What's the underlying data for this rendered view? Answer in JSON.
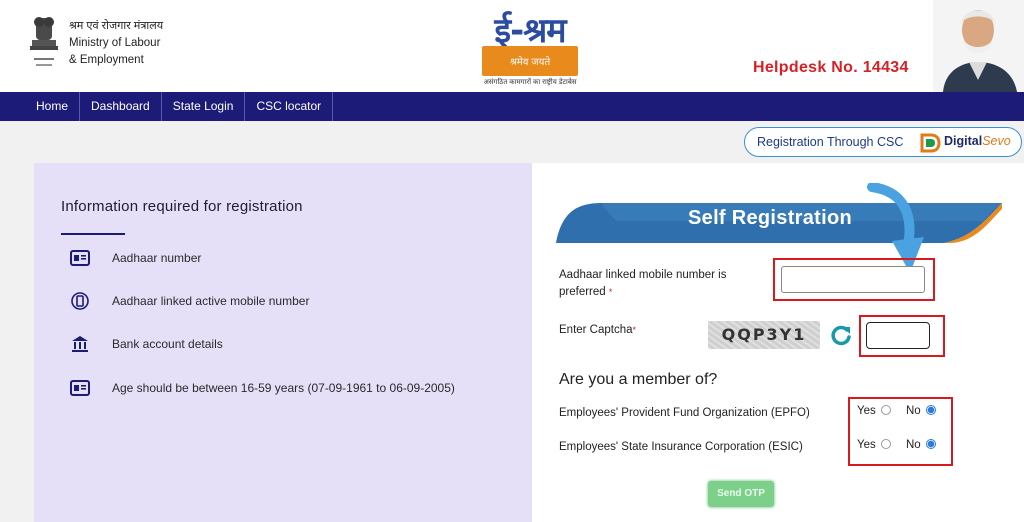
{
  "header": {
    "ministry_hindi": "श्रम एवं रोजगार मंत्रालय",
    "ministry_line1": "Ministry of Labour",
    "ministry_line2": "& Employment",
    "logo_title": "ई-श्रम",
    "logo_subtitle": "श्रमेव जयते",
    "logo_tagline": "असंगठित कामगारों का राष्ट्रीय डेटाबेस",
    "helpdesk": "Helpdesk No. 14434",
    "icons": [
      "national-emblem",
      "eshram-logo",
      "portrait-photo"
    ]
  },
  "nav": {
    "items": [
      "Home",
      "Dashboard",
      "State Login",
      "CSC locator"
    ],
    "bg_color": "#1d1b78"
  },
  "csc": {
    "label": "Registration Through CSC",
    "brand": "Digital",
    "brand_italic": "Sevo"
  },
  "info": {
    "title": "Information required for registration",
    "items": [
      {
        "icon": "id-card-icon",
        "text": "Aadhaar number"
      },
      {
        "icon": "mobile-phone-icon",
        "text": "Aadhaar linked active mobile number"
      },
      {
        "icon": "bank-icon",
        "text": "Bank account details"
      },
      {
        "icon": "id-card-icon",
        "text": "Age should be between 16-59 years (07-09-1961 to 06-09-2005)"
      }
    ]
  },
  "form": {
    "banner_title": "Self Registration",
    "mobile_label_1": "Aadhaar linked mobile number is",
    "mobile_label_2": "preferred",
    "mobile_value": "",
    "captcha_label": "Enter Captcha",
    "captcha_text": "QQP3Y1",
    "captcha_value": "",
    "member_question": "Are you a member of?",
    "epfo_label": "Employees' Provident Fund Organization (EPFO)",
    "esic_label": "Employees' State Insurance Corporation (ESIC)",
    "yes_label": "Yes",
    "no_label": "No",
    "epfo_selected": "No",
    "esic_selected": "No",
    "send_otp": "Send OTP"
  },
  "colors": {
    "accent_blue": "#2c4ca0",
    "helpdesk_red": "#d42227",
    "highlight_red": "#d71920",
    "panel_lavender": "#e5e0f8",
    "banner_blue": "#2f6fad",
    "otp_green": "#7cd08a"
  }
}
